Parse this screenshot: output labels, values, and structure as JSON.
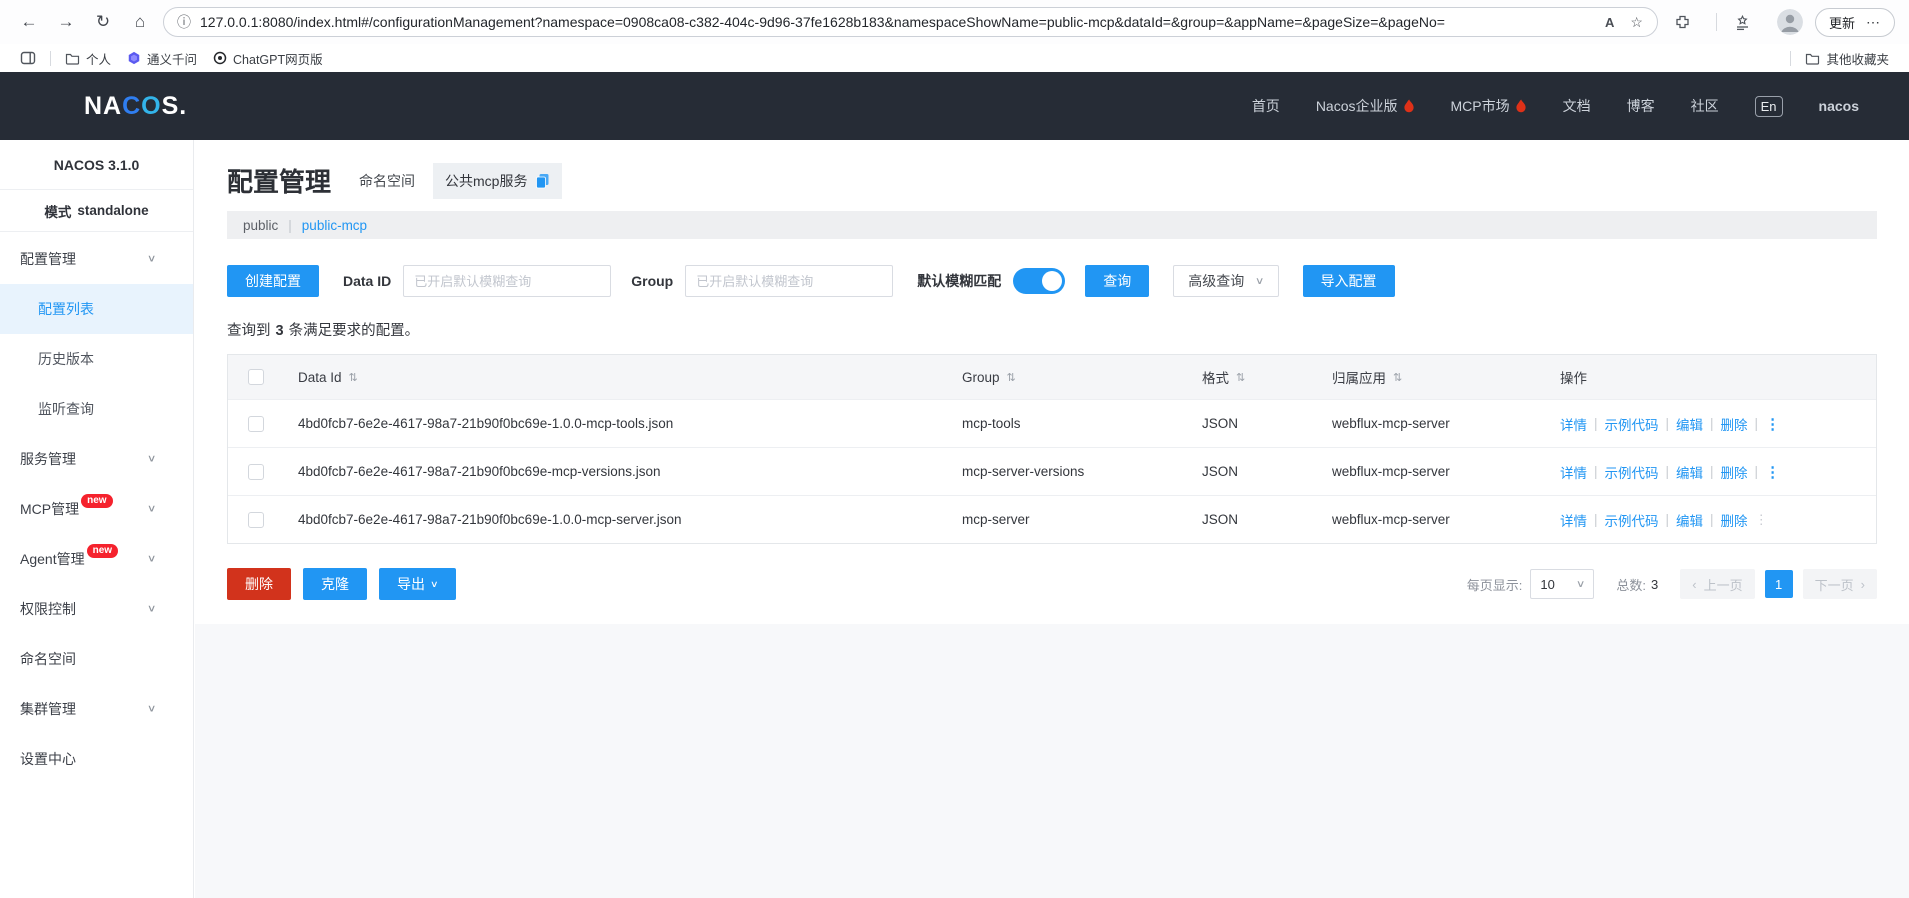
{
  "browser": {
    "url": "127.0.0.1:8080/index.html#/configurationManagement?namespace=0908ca08-c382-404c-9d96-37fe1628b183&namespaceShowName=public-mcp&dataId=&group=&appName=&pageSize=&pageNo=",
    "update_label": "更新",
    "bookmarks": {
      "personal": "个人",
      "qwen": "通义千问",
      "chatgpt": "ChatGPT网页版",
      "other": "其他收藏夹"
    }
  },
  "icons": {
    "back": "←",
    "forward": "→",
    "refresh": "↻",
    "home": "⌂",
    "info": "ⓘ",
    "read_aloud": "A",
    "star": "☆",
    "more": "⋯",
    "chevron_down": "∨",
    "sort": "⇅",
    "dots": "⋮",
    "pipe": "|",
    "prev": "‹",
    "next": "›"
  },
  "header": {
    "logo_na": "NA",
    "logo_c": "C",
    "logo_o": "O",
    "logo_s": "S.",
    "nav": [
      {
        "label": "首页"
      },
      {
        "label": "Nacos企业版"
      },
      {
        "label": "MCP市场"
      },
      {
        "label": "文档"
      },
      {
        "label": "博客"
      },
      {
        "label": "社区"
      }
    ],
    "lang": "En",
    "user": "nacos"
  },
  "sidebar": {
    "version": "NACOS 3.1.0",
    "mode_label": "模式",
    "mode_value": "standalone",
    "items": [
      {
        "label": "配置管理"
      },
      {
        "label": "配置列表"
      },
      {
        "label": "历史版本"
      },
      {
        "label": "监听查询"
      },
      {
        "label": "服务管理"
      },
      {
        "label": "MCP管理",
        "badge": "new"
      },
      {
        "label": "Agent管理",
        "badge": "new"
      },
      {
        "label": "权限控制"
      },
      {
        "label": "命名空间"
      },
      {
        "label": "集群管理"
      },
      {
        "label": "设置中心"
      }
    ]
  },
  "page": {
    "title": "配置管理",
    "namespace_label": "命名空间",
    "namespace_tab": "公共mcp服务",
    "breadcrumb": {
      "parent": "public",
      "current": "public-mcp"
    },
    "toolbar": {
      "create": "创建配置",
      "data_id_label": "Data ID",
      "data_id_placeholder": "已开启默认模糊查询",
      "group_label": "Group",
      "group_placeholder": "已开启默认模糊查询",
      "fuzzy_label": "默认模糊匹配",
      "search": "查询",
      "advanced": "高级查询",
      "import": "导入配置"
    },
    "result": {
      "prefix": "查询到",
      "count": "3",
      "suffix": "条满足要求的配置。"
    },
    "table": {
      "columns": [
        "Data Id",
        "Group",
        "格式",
        "归属应用",
        "操作"
      ],
      "actions": [
        "详情",
        "示例代码",
        "编辑",
        "删除"
      ],
      "rows": [
        {
          "data_id": "4bd0fcb7-6e2e-4617-98a7-21b90f0bc69e-1.0.0-mcp-tools.json",
          "group": "mcp-tools",
          "format": "JSON",
          "app": "webflux-mcp-server"
        },
        {
          "data_id": "4bd0fcb7-6e2e-4617-98a7-21b90f0bc69e-mcp-versions.json",
          "group": "mcp-server-versions",
          "format": "JSON",
          "app": "webflux-mcp-server"
        },
        {
          "data_id": "4bd0fcb7-6e2e-4617-98a7-21b90f0bc69e-1.0.0-mcp-server.json",
          "group": "mcp-server",
          "format": "JSON",
          "app": "webflux-mcp-server"
        }
      ]
    },
    "footer": {
      "delete": "删除",
      "clone": "克隆",
      "export": "导出",
      "page_size_label": "每页显示:",
      "page_size": "10",
      "total_label": "总数:",
      "total": "3",
      "prev": "上一页",
      "page": "1",
      "next": "下一页"
    }
  },
  "colors": {
    "accent": "#2196f3",
    "danger": "#d2331c",
    "header_bg": "#262c36",
    "badge_red": "#f5222d",
    "active_item_bg": "#e8f3fd"
  }
}
